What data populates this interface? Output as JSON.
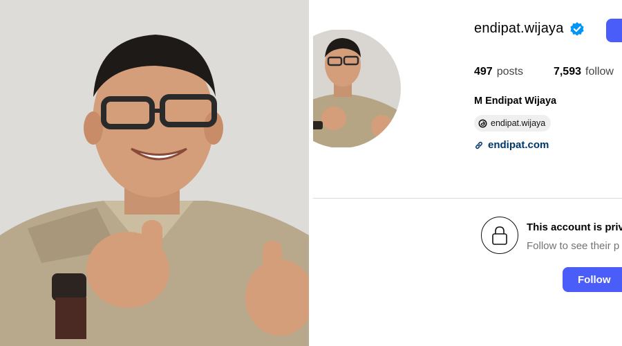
{
  "profile": {
    "username": "endipat.wijaya",
    "stats": [
      {
        "value": "497",
        "label": "posts"
      },
      {
        "value": "7,593",
        "label": "follow"
      }
    ],
    "full_name": "M Endipat Wijaya",
    "threads_handle": "endipat.wijaya",
    "website": "endipat.com"
  },
  "private_notice": {
    "title": "This account is priva",
    "subtitle": "Follow to see their p",
    "follow_label": "Follow"
  },
  "icons": {
    "verified": "verified-badge-icon",
    "threads": "threads-icon",
    "link": "link-icon",
    "lock": "lock-icon"
  },
  "colors": {
    "accent": "#4a5df9",
    "verified": "#0095f6",
    "link": "#00376b"
  }
}
